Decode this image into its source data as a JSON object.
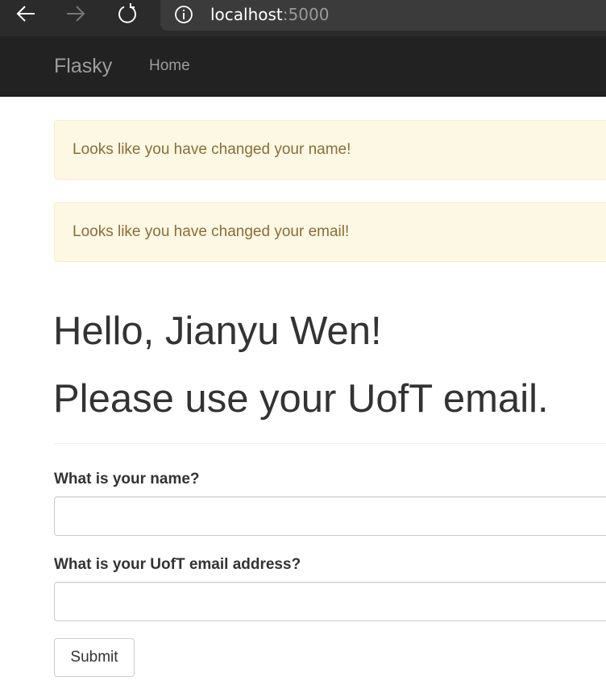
{
  "browser": {
    "icons": {
      "back": "arrow-left-icon",
      "forward": "arrow-right-icon",
      "reload": "reload-icon",
      "site_info": "info-icon"
    },
    "url_host": "localhost",
    "url_port": ":5000"
  },
  "navbar": {
    "brand": "Flasky",
    "items": [
      {
        "label": "Home"
      }
    ]
  },
  "flash_messages": [
    {
      "text": "Looks like you have changed your name!"
    },
    {
      "text": "Looks like you have changed your email!"
    }
  ],
  "page_header": {
    "greeting": "Hello, Jianyu Wen!",
    "instruction": "Please use your UofT email."
  },
  "form": {
    "name_label": "What is your name?",
    "name_value": "",
    "email_label": "What is your UofT email address?",
    "email_value": "",
    "submit_label": "Submit"
  },
  "colors": {
    "navbar_bg": "#222222",
    "navbar_text": "#9d9d9d",
    "alert_bg": "#fcf8e3",
    "alert_border": "#faebcc",
    "alert_text": "#8a6d3b",
    "text": "#333333"
  }
}
